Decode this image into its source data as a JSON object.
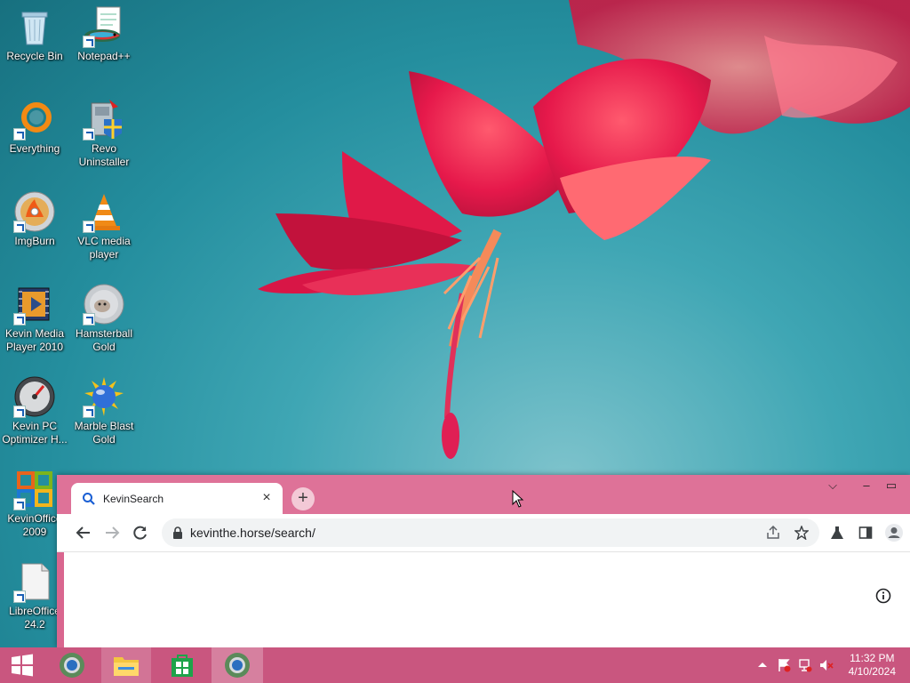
{
  "desktop": {
    "icons": [
      {
        "label": "Recycle Bin"
      },
      {
        "label": "Notepad++"
      },
      {
        "label": "Everything"
      },
      {
        "label": "Revo Uninstaller"
      },
      {
        "label": "ImgBurn"
      },
      {
        "label": "VLC media player"
      },
      {
        "label": "Kevin Media Player 2010"
      },
      {
        "label": "Hamsterball Gold"
      },
      {
        "label": "Kevin PC Optimizer H..."
      },
      {
        "label": "Marble Blast Gold"
      },
      {
        "label": "KevinOffice 2009"
      },
      {
        "label": "LibreOffice 24.2"
      }
    ]
  },
  "browser": {
    "tab": {
      "title": "KevinSearch",
      "close_glyph": "×"
    },
    "new_tab_glyph": "+",
    "window_controls": {
      "chevron": "⌵",
      "minimize": "–",
      "maximize": "▭"
    },
    "address": {
      "url": "kevinthe.horse/search/"
    }
  },
  "taskbar": {
    "clock": {
      "time": "11:32 PM",
      "date": "4/10/2024"
    },
    "accent": "#c9567f"
  }
}
